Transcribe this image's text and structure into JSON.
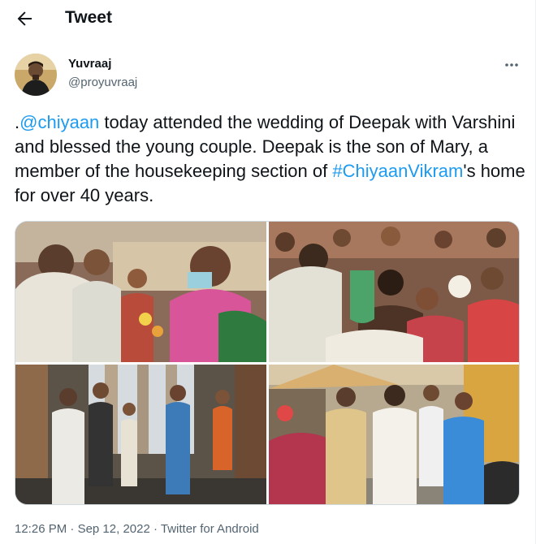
{
  "header": {
    "title": "Tweet",
    "back_icon": "arrow-left-icon"
  },
  "author": {
    "name": "Yuvraaj",
    "handle": "@proyuvraaj"
  },
  "menu": {
    "icon": "more-dots-icon"
  },
  "tweet": {
    "prefix": ".",
    "mention": "@chiyaan",
    "text1": " today attended the wedding of Deepak with Varshini and blessed the young couple. Deepak is the son of Mary, a member of the housekeeping section of ",
    "hashtag": "#ChiyaanVikram",
    "text2": "'s home for over 40 years."
  },
  "meta": {
    "time": "12:26 PM",
    "sep1": " · ",
    "date": "Sep 12, 2022",
    "sep2": " · ",
    "source": "Twitter for Android"
  },
  "colors": {
    "link": "#1d9bf0",
    "secondary": "#536471",
    "text": "#0f1419"
  }
}
